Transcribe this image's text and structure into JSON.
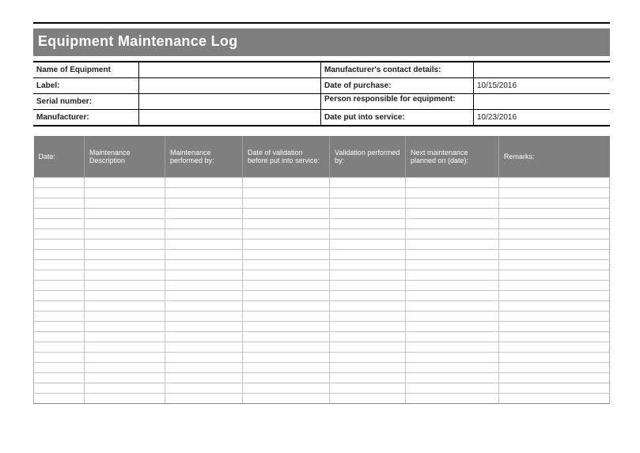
{
  "title": "Equipment Maintenance Log",
  "info": {
    "name_of_equipment_label": "Name of Equipment",
    "name_of_equipment_value": "",
    "manufacturer_contact_label": "Manufacturer's contact details:",
    "manufacturer_contact_value": "",
    "label_label": "Label:",
    "label_value": "",
    "date_of_purchase_label": "Date of purchase:",
    "date_of_purchase_value": "10/15/2016",
    "serial_number_label": "Serial number:",
    "serial_number_value": "",
    "person_responsible_label": "Person responsible for equipment:",
    "person_responsible_value": "",
    "manufacturer_label": "Manufacturer:",
    "manufacturer_value": "",
    "date_put_into_service_label": "Date put into service:",
    "date_put_into_service_value": "10/23/2016"
  },
  "log": {
    "headers": [
      "Date:",
      "Maintenance Description",
      "Maintenance performed by:",
      "Date of validation before put into service:",
      "Validation performed by:",
      "Next maintenance planned on (date):",
      "Remarks:"
    ],
    "row_count": 22
  }
}
